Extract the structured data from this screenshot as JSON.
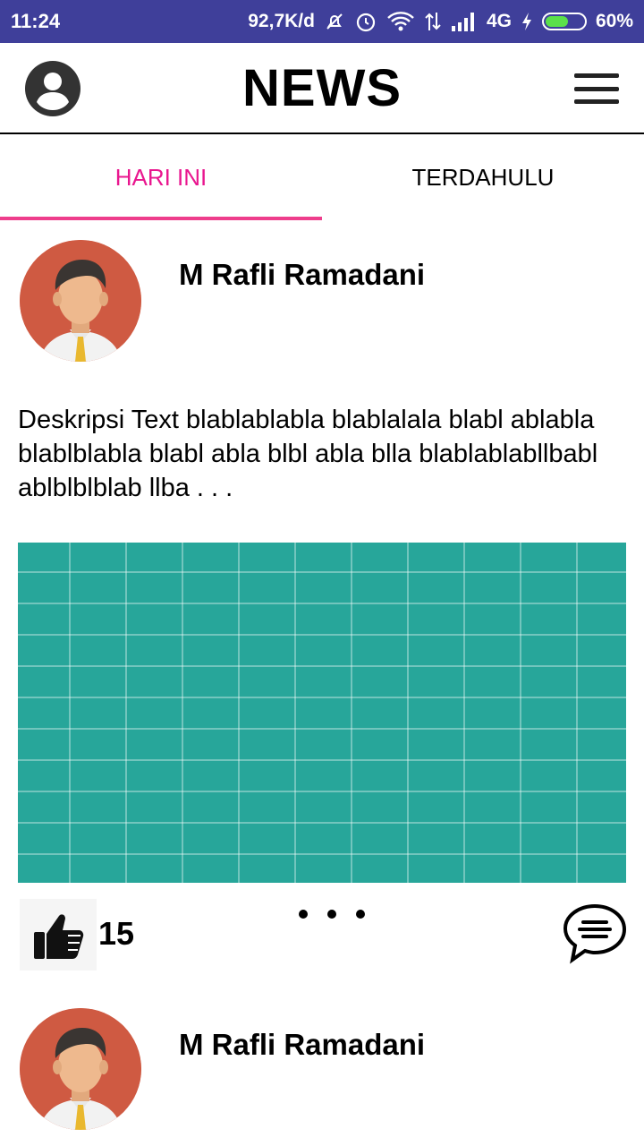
{
  "status_bar": {
    "time": "11:24",
    "speed": "92,7K/d",
    "network": "4G",
    "battery_percent": "60%",
    "battery_level": 0.6,
    "icons": [
      "alarm-off-icon",
      "alarm-icon",
      "wifi-icon",
      "data-arrows-icon",
      "signal-icon",
      "charging-icon",
      "battery-icon"
    ]
  },
  "appbar": {
    "title": "NEWS",
    "icons": [
      "profile-icon",
      "menu-icon"
    ]
  },
  "tabs": [
    {
      "label": "HARI INI",
      "active": true
    },
    {
      "label": "TERDAHULU",
      "active": false
    }
  ],
  "posts": [
    {
      "author": "M Rafli Ramadani",
      "description": "Deskripsi Text blablablabla blablalala blabl ablabla blablblabla blabl abla blbl abla blla blablablabllbabl ablblblblab llba . . .",
      "likes": "15",
      "image_color": "#27a69a"
    },
    {
      "author": "M Rafli Ramadani"
    }
  ],
  "colors": {
    "status_bar": "#3f3f9a",
    "active_tab": "#e9178f",
    "tab_indicator": "#ee3e8c",
    "avatar_bg": "#cf5a42"
  }
}
